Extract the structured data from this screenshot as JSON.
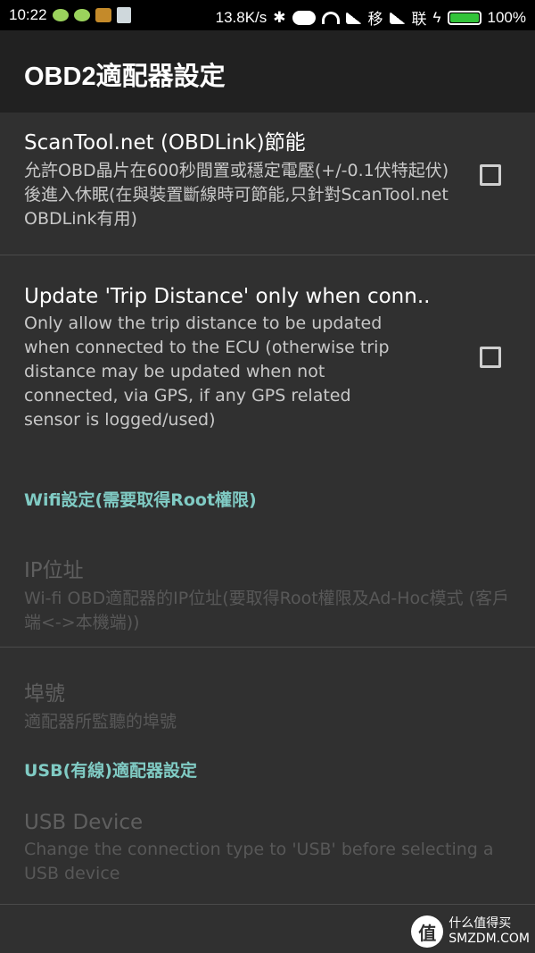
{
  "status_bar": {
    "time": "10:22",
    "net_speed": "13.8K/s",
    "carrier1": "移",
    "carrier2": "联",
    "battery": "100%"
  },
  "app_bar": {
    "title": "OBD2適配器設定"
  },
  "prefs": {
    "scantool": {
      "title": "ScanTool.net (OBDLink)節能",
      "summary": "允許OBD晶片在600秒間置或穩定電壓(+/-0.1伏特起伏)後進入休眠(在與裝置斷線時可節能,只針對ScanTool.net OBDLink有用)",
      "checked": false
    },
    "trip": {
      "title": "Update 'Trip Distance' only when conn..",
      "summary": "Only allow the trip distance to be updated when connected to the ECU (otherwise trip distance may be updated when not connected, via GPS, if any GPS related sensor is logged/used)",
      "checked": false
    },
    "wifi_category": "Wifi設定(需要取得Root權限)",
    "ip": {
      "title": "IP位址",
      "summary": "Wi-fi OBD適配器的IP位址(要取得Root權限及Ad-Hoc模式 (客戶端<->本機端))"
    },
    "port": {
      "title": "埠號",
      "summary": "適配器所監聽的埠號"
    },
    "usb_category": "USB(有線)適配器設定",
    "usb_device": {
      "title": "USB Device",
      "summary": "Change the connection type to 'USB' before selecting a USB device"
    }
  },
  "watermark": {
    "badge": "值",
    "line1": "什么值得买",
    "line2": "SMZDM.COM"
  }
}
